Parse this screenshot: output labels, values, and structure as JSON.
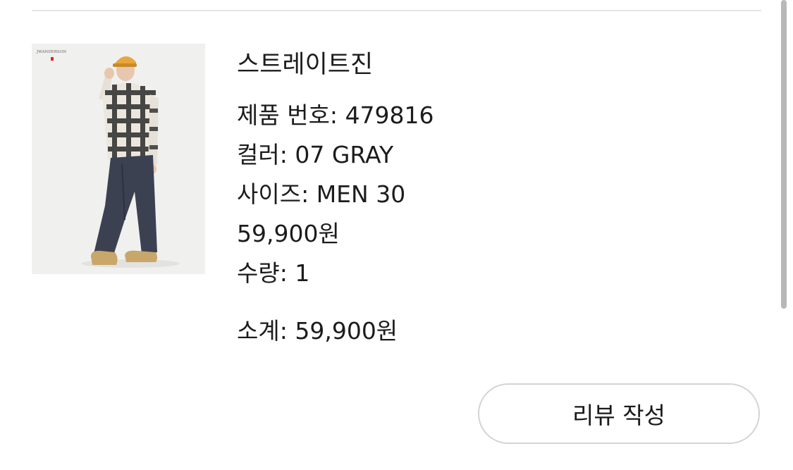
{
  "product": {
    "name": "스트레이트진",
    "product_number_label": "제품 번호:",
    "product_number": "479816",
    "color_label": "컬러:",
    "color": "07 GRAY",
    "size_label": "사이즈:",
    "size": "MEN 30",
    "price": "59,900원",
    "quantity_label": "수량:",
    "quantity": "1",
    "image_brand_text": "JWANDERSON"
  },
  "summary": {
    "subtotal_label": "소계:",
    "subtotal": "59,900원"
  },
  "actions": {
    "review_label": "리뷰 작성"
  },
  "colors": {
    "divider": "#e6e6e6",
    "button_border": "#d4d4d4",
    "text": "#1c1c1c"
  }
}
